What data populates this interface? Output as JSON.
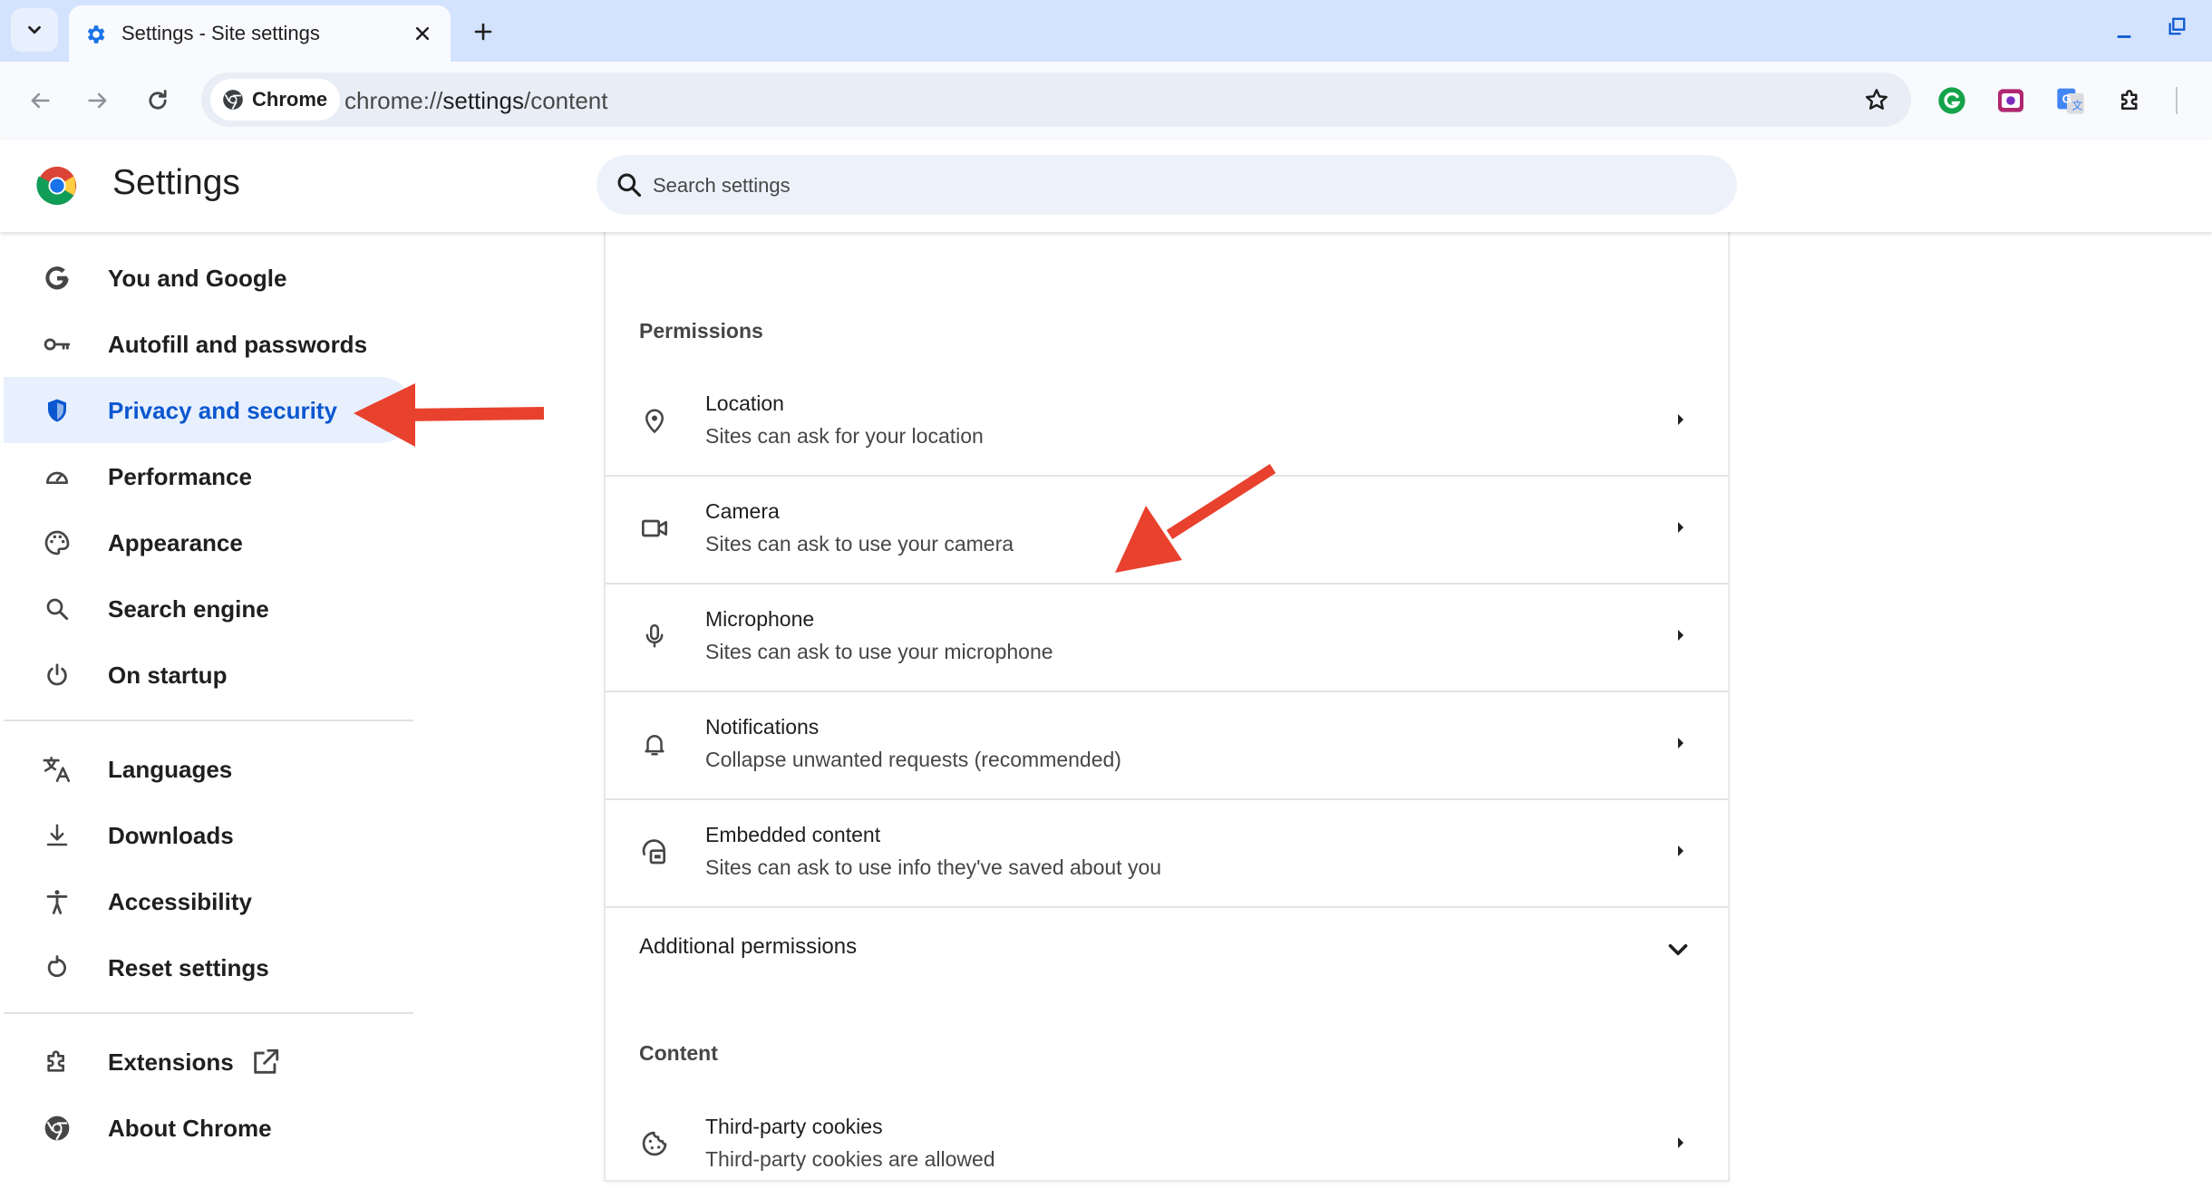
{
  "browser": {
    "tab": {
      "title": "Settings - Site settings",
      "favicon": "gear-icon"
    },
    "address": {
      "chip_label": "Chrome",
      "url_scheme": "chrome://",
      "url_host": "settings",
      "url_path": "/content"
    },
    "colors": {
      "tabstrip": "#d3e3fd",
      "toolbar": "#f8fafd",
      "omnibox": "#e9eef6",
      "accent": "#0b57d0",
      "annotation_arrow": "#e8412d"
    }
  },
  "settings": {
    "title": "Settings",
    "search_placeholder": "Search settings"
  },
  "sidebar": {
    "items": [
      {
        "label": "You and Google",
        "icon": "google-g-icon"
      },
      {
        "label": "Autofill and passwords",
        "icon": "key-icon"
      },
      {
        "label": "Privacy and security",
        "icon": "shield-icon",
        "active": true
      },
      {
        "label": "Performance",
        "icon": "speedometer-icon"
      },
      {
        "label": "Appearance",
        "icon": "palette-icon"
      },
      {
        "label": "Search engine",
        "icon": "search-icon"
      },
      {
        "label": "On startup",
        "icon": "power-icon"
      },
      {
        "label": "Languages",
        "icon": "translate-icon"
      },
      {
        "label": "Downloads",
        "icon": "download-icon"
      },
      {
        "label": "Accessibility",
        "icon": "accessibility-icon"
      },
      {
        "label": "Reset settings",
        "icon": "reset-icon"
      },
      {
        "label": "Extensions",
        "icon": "puzzle-icon"
      },
      {
        "label": "About Chrome",
        "icon": "chrome-icon"
      }
    ]
  },
  "main": {
    "permissions_heading": "Permissions",
    "permissions": [
      {
        "title": "Location",
        "subtitle": "Sites can ask for your location",
        "icon": "location-pin-icon"
      },
      {
        "title": "Camera",
        "subtitle": "Sites can ask to use your camera",
        "icon": "camera-icon"
      },
      {
        "title": "Microphone",
        "subtitle": "Sites can ask to use your microphone",
        "icon": "microphone-icon"
      },
      {
        "title": "Notifications",
        "subtitle": "Collapse unwanted requests (recommended)",
        "icon": "bell-icon"
      },
      {
        "title": "Embedded content",
        "subtitle": "Sites can ask to use info they've saved about you",
        "icon": "embedded-content-icon"
      }
    ],
    "additional_permissions": "Additional permissions",
    "content_heading": "Content",
    "content": [
      {
        "title": "Third-party cookies",
        "subtitle": "Third-party cookies are allowed",
        "icon": "cookie-icon"
      }
    ]
  }
}
